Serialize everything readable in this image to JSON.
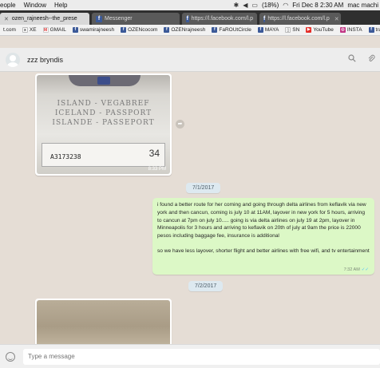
{
  "menubar": {
    "items": [
      "eople",
      "Window",
      "Help"
    ],
    "battery": "(18%)",
    "datetime": "Fri Dec 8  2:30 AM",
    "user": "mac machi"
  },
  "tabs": [
    {
      "label": "ozen_rajneesh--the_prese",
      "active": true
    },
    {
      "label": "Messenger",
      "active": false
    },
    {
      "label": "https://l.facebook.com/l.p",
      "active": false
    },
    {
      "label": "https://l.facebook.com/l.p",
      "active": false
    }
  ],
  "bookmarks": [
    {
      "label": "t.com",
      "icon": "doc-icon"
    },
    {
      "label": "XE",
      "icon": "xe-icon"
    },
    {
      "label": "GMAIL",
      "icon": "gmail-icon"
    },
    {
      "label": "swamirajneesh",
      "icon": "facebook-icon"
    },
    {
      "label": "OZENcocom",
      "icon": "facebook-icon"
    },
    {
      "label": "OZENrajneesh",
      "icon": "facebook-icon"
    },
    {
      "label": "FaROUtCircle",
      "icon": "facebook-icon"
    },
    {
      "label": "MAYA",
      "icon": "facebook-icon"
    },
    {
      "label": "SN",
      "icon": "doc-icon"
    },
    {
      "label": "YouTube",
      "icon": "youtube-icon"
    },
    {
      "label": "INSTA",
      "icon": "instagram-icon"
    },
    {
      "label": "tra",
      "icon": "facebook-icon"
    }
  ],
  "chat": {
    "contact_name": "zzz bryndis",
    "image1": {
      "lines": [
        "ISLAND - VEGABREF",
        "ICELAND - PASSPORT",
        "ISLANDE - PASSEPORT"
      ],
      "passport_number": "A3173238",
      "page_number": "34",
      "time": "8:33 PM"
    },
    "date1": "7/1/2017",
    "outgoing": {
      "para1": "i found a better route for her coming and going through delta airlines from keflavik via new york and then cancun, coming is july 10 at 11AM, layover in new york for 5 hours, arriving to cancun at 7pm on july 10..... going is via delta airlines on july 19 at 2pm, layover in Minneapolis for 3 hours and arriving to keflavik on 20th of july at 9am the price is 22000 pesos including baggage fee, insurance is additional",
      "para2": "so we have less layover, shorter flight and better airlines with free wifi, and tv entertainment",
      "time": "7:32 AM"
    },
    "date2": "7/2/2017"
  },
  "composer": {
    "placeholder": "Type a message"
  },
  "colors": {
    "chat_bg": "#e5ddd5",
    "outgoing_bubble": "#dcf8c6",
    "date_pill": "#dde9f0",
    "facebook_blue": "#3b5998"
  }
}
